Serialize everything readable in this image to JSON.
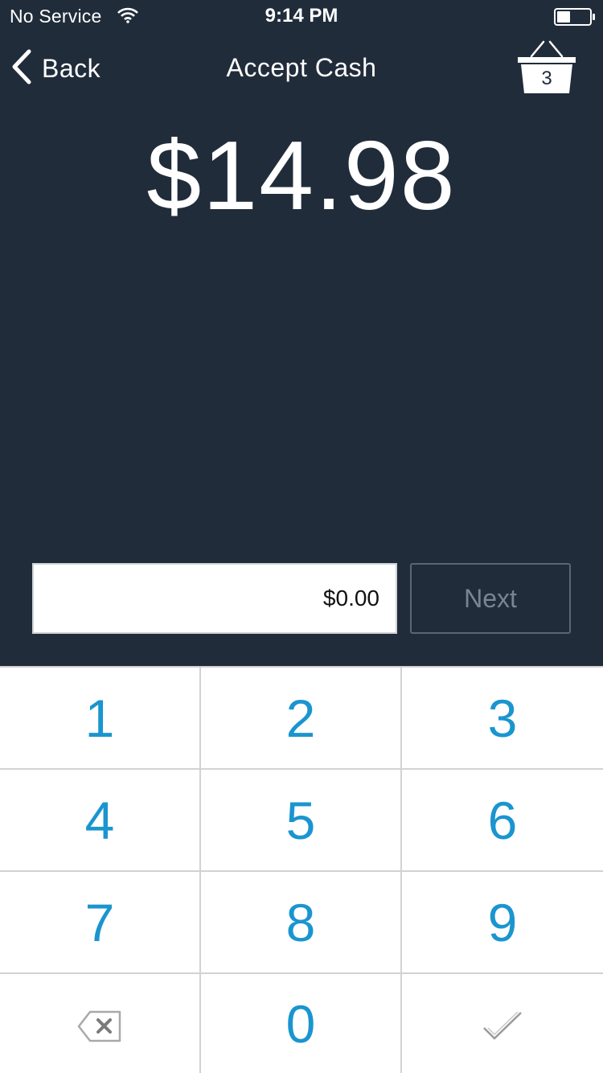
{
  "status_bar": {
    "carrier": "No Service",
    "time": "9:14 PM",
    "wifi_icon": "wifi-icon",
    "battery_icon": "battery-icon"
  },
  "nav": {
    "back_label": "Back",
    "title": "Accept Cash",
    "basket_count": "3",
    "basket_icon": "basket-icon"
  },
  "amount_due": "$14.98",
  "cash_input": {
    "value": "$0.00"
  },
  "next_label": "Next",
  "keypad": {
    "keys": [
      "1",
      "2",
      "3",
      "4",
      "5",
      "6",
      "7",
      "8",
      "9"
    ],
    "zero": "0",
    "delete_icon": "backspace-icon",
    "confirm_icon": "checkmark-icon"
  },
  "colors": {
    "header_bg": "#212c3b",
    "key_text": "#1a95cf",
    "divider": "#d2d2d2"
  }
}
